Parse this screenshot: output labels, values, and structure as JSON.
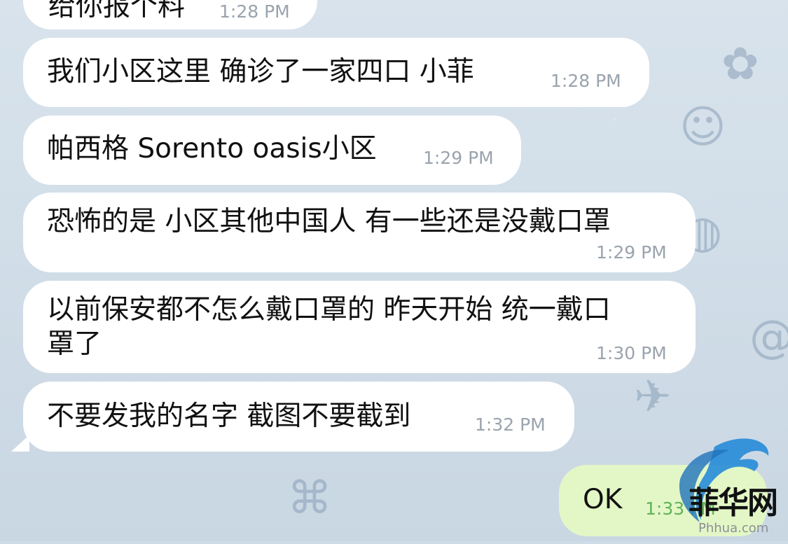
{
  "messages": [
    {
      "text": "给你报个料",
      "time": "1:28 PM"
    },
    {
      "text": "我们小区这里  确诊了一家四口  小菲",
      "time": "1:28 PM"
    },
    {
      "text": "帕西格 Sorento  oasis小区",
      "time": "1:29 PM"
    },
    {
      "text": "恐怖的是  小区其他中国人 有一些还是没戴口罩",
      "time": "1:29 PM"
    },
    {
      "line1": "以前保安都不怎么戴口罩的  昨天开始 统一戴口",
      "line2": "罩了",
      "time": "1:30 PM"
    },
    {
      "text": "不要发我的名字  截图不要截到",
      "time": "1:32 PM"
    }
  ],
  "outgoing": {
    "text": "OK",
    "time": "1:33 PM"
  },
  "watermark": {
    "brand": "菲华网",
    "domain": "Phhua.com"
  },
  "colors": {
    "incoming_bubble": "#ffffff",
    "outgoing_bubble": "#e3f7c6",
    "timestamp": "#9aa3ad",
    "outgoing_timestamp": "#5fb35a",
    "background": "#cfdbe6"
  }
}
